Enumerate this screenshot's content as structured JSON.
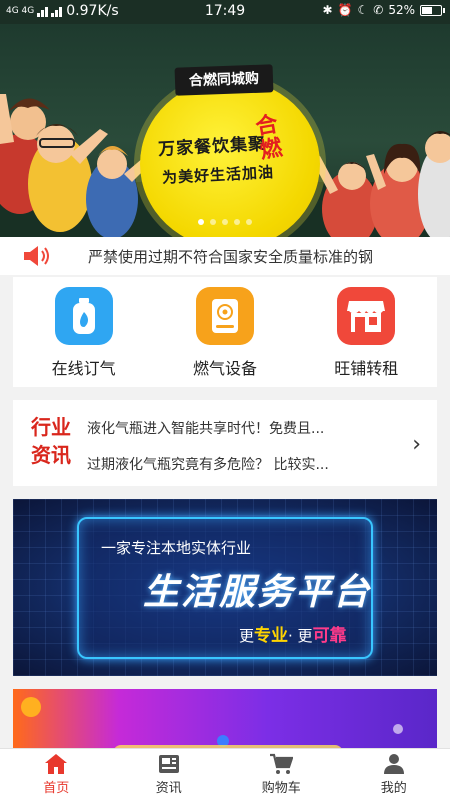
{
  "status_bar": {
    "signal_text": "4G 4G",
    "speed": "0.97K/s",
    "time": "17:49",
    "battery_percent": "52%",
    "battery_level": 0.52
  },
  "banner": {
    "tag": "合燃同城购",
    "line1": "万家餐饮集聚",
    "brand": "合燃",
    "line2": "为美好生活加油",
    "slide_count": 5,
    "active_slide": 0
  },
  "notice": {
    "text": "严禁使用过期不符合国家安全质量标准的钢"
  },
  "services": [
    {
      "label": "在线订气",
      "icon": "gas-cylinder-icon",
      "color": "#2fa6f2"
    },
    {
      "label": "燃气设备",
      "icon": "gas-stove-icon",
      "color": "#f7a21b"
    },
    {
      "label": "旺铺转租",
      "icon": "storefront-icon",
      "color": "#f0483a"
    }
  ],
  "news": {
    "tag_line1": "行业",
    "tag_line2": "资讯",
    "items": [
      "液化气瓶进入智能共享时代！免费且...",
      "过期液化气瓶究竟有多危险？ 比较实..."
    ]
  },
  "promo": {
    "line1": "一家专注本地实体行业",
    "line2": "生活服务平台",
    "line3_prefix": "更",
    "line3_a": "专业",
    "line3_sep": "· 更",
    "line3_b": "可靠"
  },
  "tabs": [
    {
      "label": "首页",
      "icon": "home-icon",
      "active": true
    },
    {
      "label": "资讯",
      "icon": "news-icon",
      "active": false
    },
    {
      "label": "购物车",
      "icon": "cart-icon",
      "active": false
    },
    {
      "label": "我的",
      "icon": "user-icon",
      "active": false
    }
  ],
  "colors": {
    "accent": "#e8382d",
    "banner_yellow": "#f4d800",
    "news_red": "#d9261c",
    "promo_blue": "#1d4fae"
  }
}
